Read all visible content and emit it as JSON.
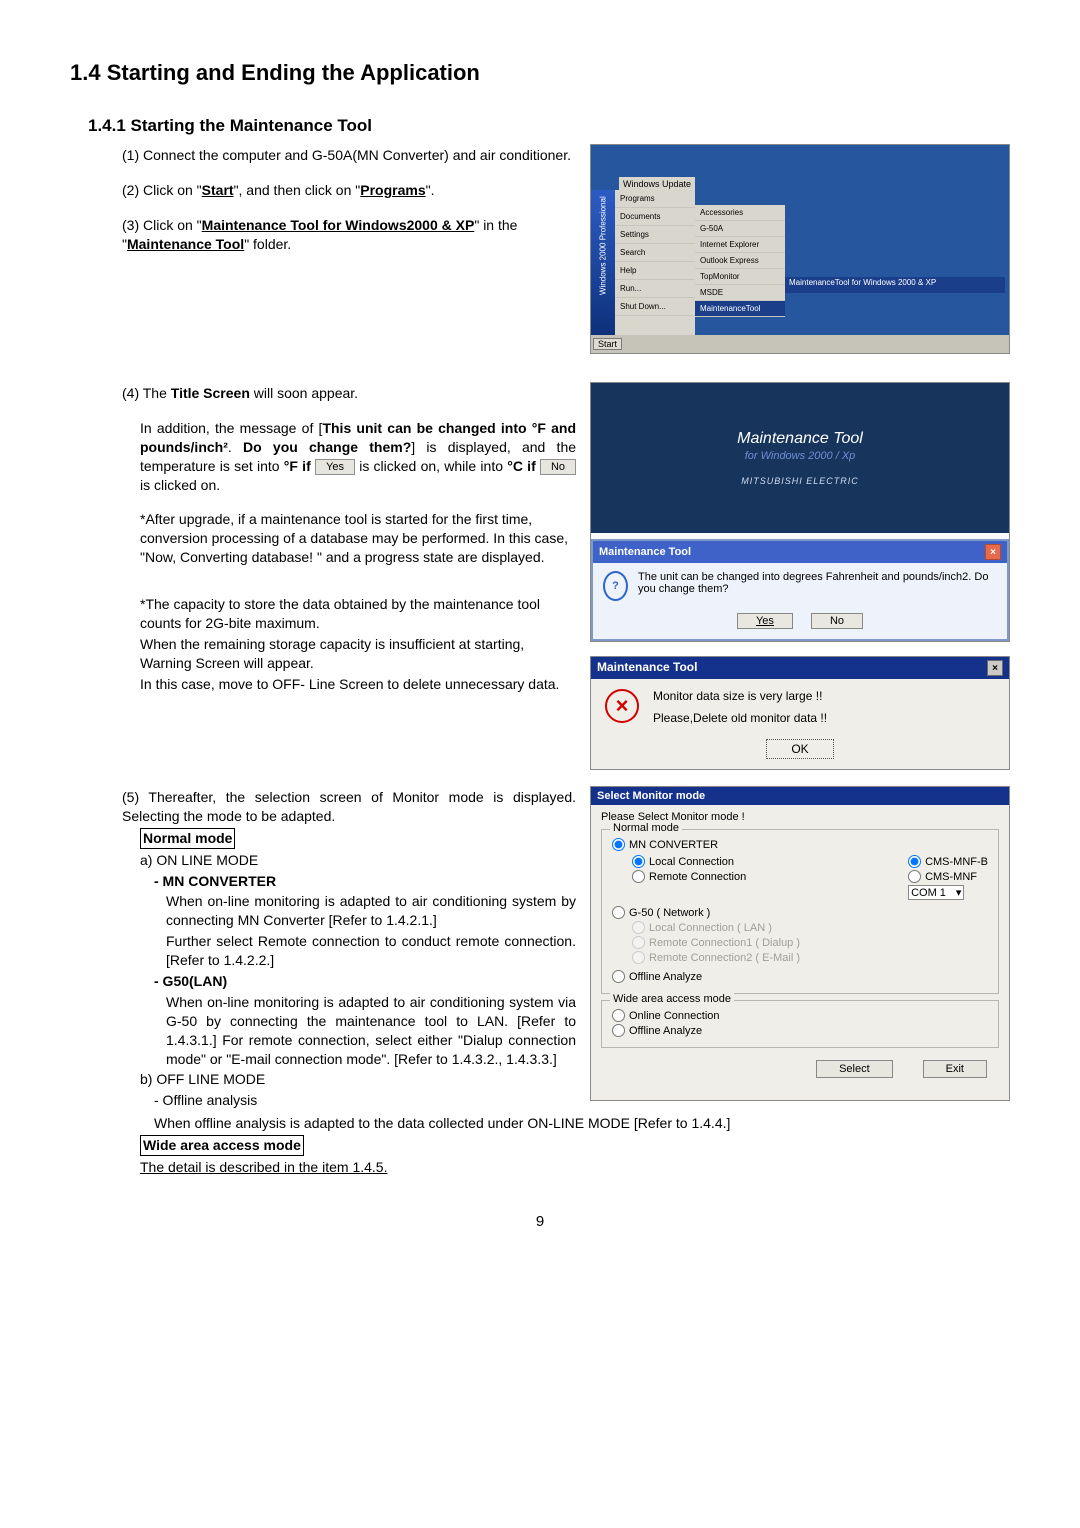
{
  "page_number": "9",
  "section": {
    "title": "1.4 Starting and Ending the Application",
    "subsection_title": "1.4.1 Starting the Maintenance Tool"
  },
  "steps": {
    "s1": "(1) Connect the computer and G-50A(MN Converter) and air conditioner.",
    "s2_a": "(2) Click on \"",
    "s2_b": "Start",
    "s2_c": "\", and then click on \"",
    "s2_d": "Programs",
    "s2_e": "\".",
    "s3_a": "(3) Click on \"",
    "s3_b": "Maintenance Tool for Windows2000 & XP",
    "s3_c": "\" in the \"",
    "s3_d": "Maintenance Tool",
    "s3_e": "\" folder.",
    "s4_intro": "(4) The ",
    "s4_bold": "Title Screen",
    "s4_tail": " will soon appear.",
    "s4_para_a": "In addition, the message of [",
    "s4_para_b": "This unit can be changed into °F and pounds/inch²",
    "s4_para_c": ". ",
    "s4_para_d": "Do you change them?",
    "s4_para_e": "] is displayed, and the temperature is set into ",
    "s4_para_f": "°F if",
    "s4_para_g": " is clicked on, while into ",
    "s4_para_h": "°C if",
    "s4_para_i": " is clicked on.",
    "s4_note1": "*After upgrade, if a maintenance tool is started for the first time, conversion processing of a database may be performed. In this case, \"Now, Converting database! \" and a progress state are displayed.",
    "s4_capacity1": "*The capacity to store the data obtained by the maintenance tool counts for 2G-bite maximum.",
    "s4_capacity2": "When the remaining storage capacity is insufficient at starting, Warning Screen will appear.",
    "s4_capacity3": "In this case, move to OFF- Line Screen to delete unnecessary data.",
    "s5_a": "(5) Thereafter, the selection screen of Monitor mode is displayed. Selecting the mode to be adapted.",
    "normal_mode": "Normal mode",
    "s5_a1": "a) ON LINE MODE",
    "s5_mn": "- MN CONVERTER",
    "s5_mn_text1": "When on-line monitoring is adapted to air conditioning system by connecting MN Converter [Refer to 1.4.2.1.]",
    "s5_mn_text2": "Further select Remote connection to conduct remote connection. [Refer to 1.4.2.2.]",
    "s5_g50": "- G50(LAN)",
    "s5_g50_text": "When on-line monitoring is adapted to air conditioning system via G-50 by connecting the maintenance tool to LAN. [Refer to 1.4.3.1.] For remote connection, select either \"Dialup connection mode\" or \"E-mail connection mode\". [Refer to 1.4.3.2., 1.4.3.3.]",
    "s5_b": "b) OFF LINE MODE",
    "s5_off": "- Offline analysis",
    "s5_off_text": "When offline analysis is adapted to the data collected under ON-LINE MODE [Refer to 1.4.4.]",
    "wide_mode": "Wide area access mode",
    "wide_text": "The detail is described in the item 1.4.5."
  },
  "buttons": {
    "yes": "Yes",
    "no": "No",
    "ok": "OK",
    "select": "Select",
    "exit": "Exit"
  },
  "start_menu": {
    "side": "Windows 2000 Professional",
    "wu": "Windows Update",
    "menu1": [
      "Programs",
      "Documents",
      "Settings",
      "Search",
      "Help",
      "Run...",
      "Shut Down..."
    ],
    "menu2": [
      "Accessories",
      "G-50A",
      "Internet Explorer",
      "Outlook Express",
      "TopMonitor",
      "MSDE",
      "MaintenanceTool"
    ],
    "menu3": "MaintenanceTool for Windows 2000 & XP",
    "taskbar_start": "Start"
  },
  "splash": {
    "title": "Maintenance Tool",
    "sub": "for  Windows 2000 / Xp",
    "brand": "MITSUBISHI ELECTRIC"
  },
  "dialog_change": {
    "title": "Maintenance Tool",
    "msg": "The unit can be changed into degrees Fahrenheit and pounds/inch2. Do you change them?"
  },
  "dialog_warn": {
    "title": "Maintenance Tool",
    "line1": "Monitor data size is very large !!",
    "line2": "Please,Delete old monitor data !!"
  },
  "select_mode": {
    "title": "Select Monitor mode",
    "please": "Please Select Monitor mode !",
    "normal": "Normal mode",
    "mn": "MN CONVERTER",
    "local": "Local Connection",
    "remote": "Remote Connection",
    "cmsmnfb": "CMS-MNF-B",
    "cmsmnf": "CMS-MNF",
    "com": "COM 1",
    "g50": "G-50 ( Network )",
    "g50_local": "Local Connection     ( LAN )",
    "g50_r1": "Remote Connection1 ( Dialup )",
    "g50_r2": "Remote Connection2 ( E-Mail )",
    "offline": "Offline Analyze",
    "wide": "Wide area access mode",
    "online_conn": "Online Connection",
    "offline2": "Offline Analyze"
  }
}
